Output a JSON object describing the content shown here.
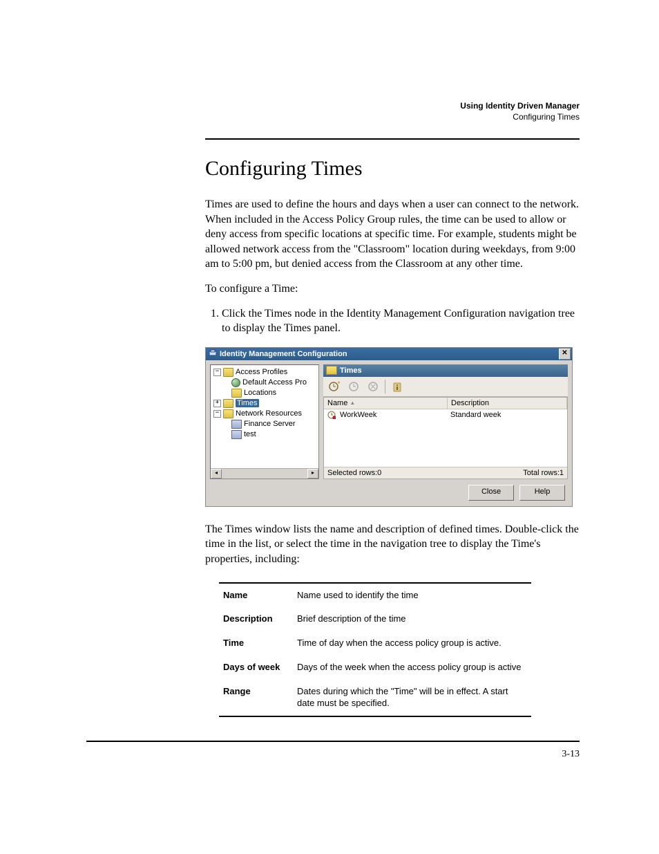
{
  "header": {
    "bold": "Using Identity Driven Manager",
    "sub": "Configuring Times"
  },
  "title": "Configuring Times",
  "para1": "Times are used to define the hours and days when a user can connect to the network. When included in the Access Policy Group rules, the time can be used to allow or deny access from specific locations at specific time. For example, students might be allowed network access from the \"Classroom\" location during weekdays, from 9:00 am to 5:00 pm, but denied access from the Classroom at any other time.",
  "para2": "To configure a Time:",
  "step1": "Click the Times node in the Identity Management Configuration navigation tree to display the Times panel.",
  "shot": {
    "title": "Identity Management Configuration",
    "tree": {
      "access_profiles": "Access Profiles",
      "default_access": "Default Access Pro",
      "locations": "Locations",
      "times": "Times",
      "network_resources": "Network Resources",
      "finance_server": "Finance Server",
      "test": "test"
    },
    "panel": {
      "heading": "Times",
      "col_name": "Name",
      "col_desc": "Description",
      "row_name": "WorkWeek",
      "row_desc": "Standard week",
      "sel_rows": "Selected rows:0",
      "tot_rows": "Total rows:1"
    },
    "close": "Close",
    "help": "Help"
  },
  "para3": "The Times window lists the name and description of defined times. Double-click the time in the list, or select the time in the navigation tree to display the Time's properties, including:",
  "tbl": {
    "r1k": "Name",
    "r1v": "Name used to identify the time",
    "r2k": "Description",
    "r2v": "Brief description of the time",
    "r3k": "Time",
    "r3v": "Time of day when the access policy group is active.",
    "r4k": "Days of week",
    "r4v": "Days of the week when the access policy group is active",
    "r5k": "Range",
    "r5v": "Dates during which the \"Time\" will be in effect. A start date must be specified."
  },
  "pagenum": "3-13"
}
